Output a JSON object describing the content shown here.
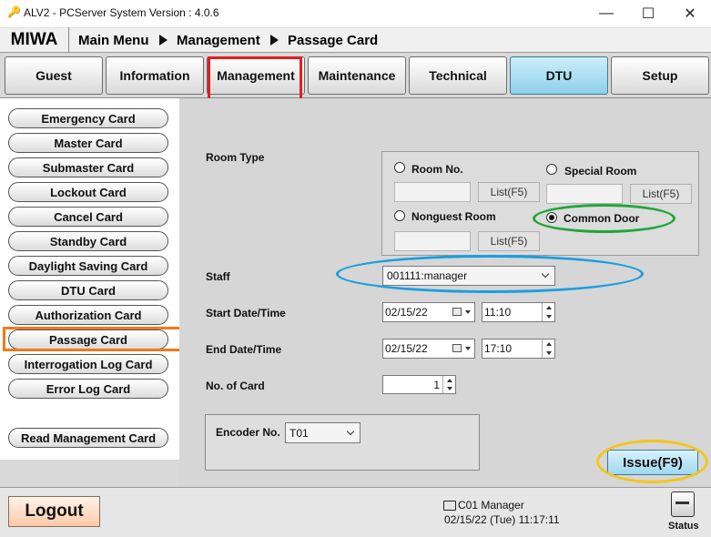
{
  "window": {
    "title": "ALV2 - PCServer System Version : 4.0.6",
    "minimize": "—",
    "maximize": "☐",
    "close": "✕"
  },
  "header": {
    "brand": "MIWA",
    "breadcrumb": [
      "Main Menu",
      "Management",
      "Passage Card"
    ]
  },
  "tabs": [
    {
      "label": "Guest"
    },
    {
      "label": "Information"
    },
    {
      "label": "Management"
    },
    {
      "label": "Maintenance"
    },
    {
      "label": "Technical"
    },
    {
      "label": "DTU"
    },
    {
      "label": "Setup"
    }
  ],
  "sidebar": {
    "items": [
      {
        "label": "Emergency Card"
      },
      {
        "label": "Master Card"
      },
      {
        "label": "Submaster Card"
      },
      {
        "label": "Lockout Card"
      },
      {
        "label": "Cancel Card"
      },
      {
        "label": "Standby Card"
      },
      {
        "label": "Daylight Saving Card"
      },
      {
        "label": "DTU Card"
      },
      {
        "label": "Authorization Card"
      },
      {
        "label": "Passage Card"
      },
      {
        "label": "Interrogation Log Card"
      },
      {
        "label": "Error Log Card"
      }
    ],
    "read_management": "Read Management Card"
  },
  "form": {
    "room_type_label": "Room Type",
    "room_no": "Room No.",
    "special_room": "Special Room",
    "nonguest_room": "Nonguest Room",
    "common_door": "Common Door",
    "list_button": "List(F5)",
    "staff_label": "Staff",
    "staff_value": "001111:manager",
    "start_label": "Start Date/Time",
    "start_date": "02/15/22",
    "start_time": "11:10",
    "end_label": "End Date/Time",
    "end_date": "02/15/22",
    "end_time": "17:10",
    "cards_label": "No. of Card",
    "cards_value": "1",
    "encoder_label": "Encoder No.",
    "encoder_value": "T01",
    "issue_button": "Issue(F9)"
  },
  "status": {
    "logout": "Logout",
    "user": "C01 Manager",
    "datetime": "02/15/22 (Tue) 11:17:11",
    "status_label": "Status"
  },
  "colors": {
    "highlight_red": "#e02020",
    "highlight_green": "#1fa63a",
    "highlight_blue": "#1a9ee0",
    "highlight_orange": "#f07a1a",
    "highlight_yellow": "#f5c518"
  }
}
